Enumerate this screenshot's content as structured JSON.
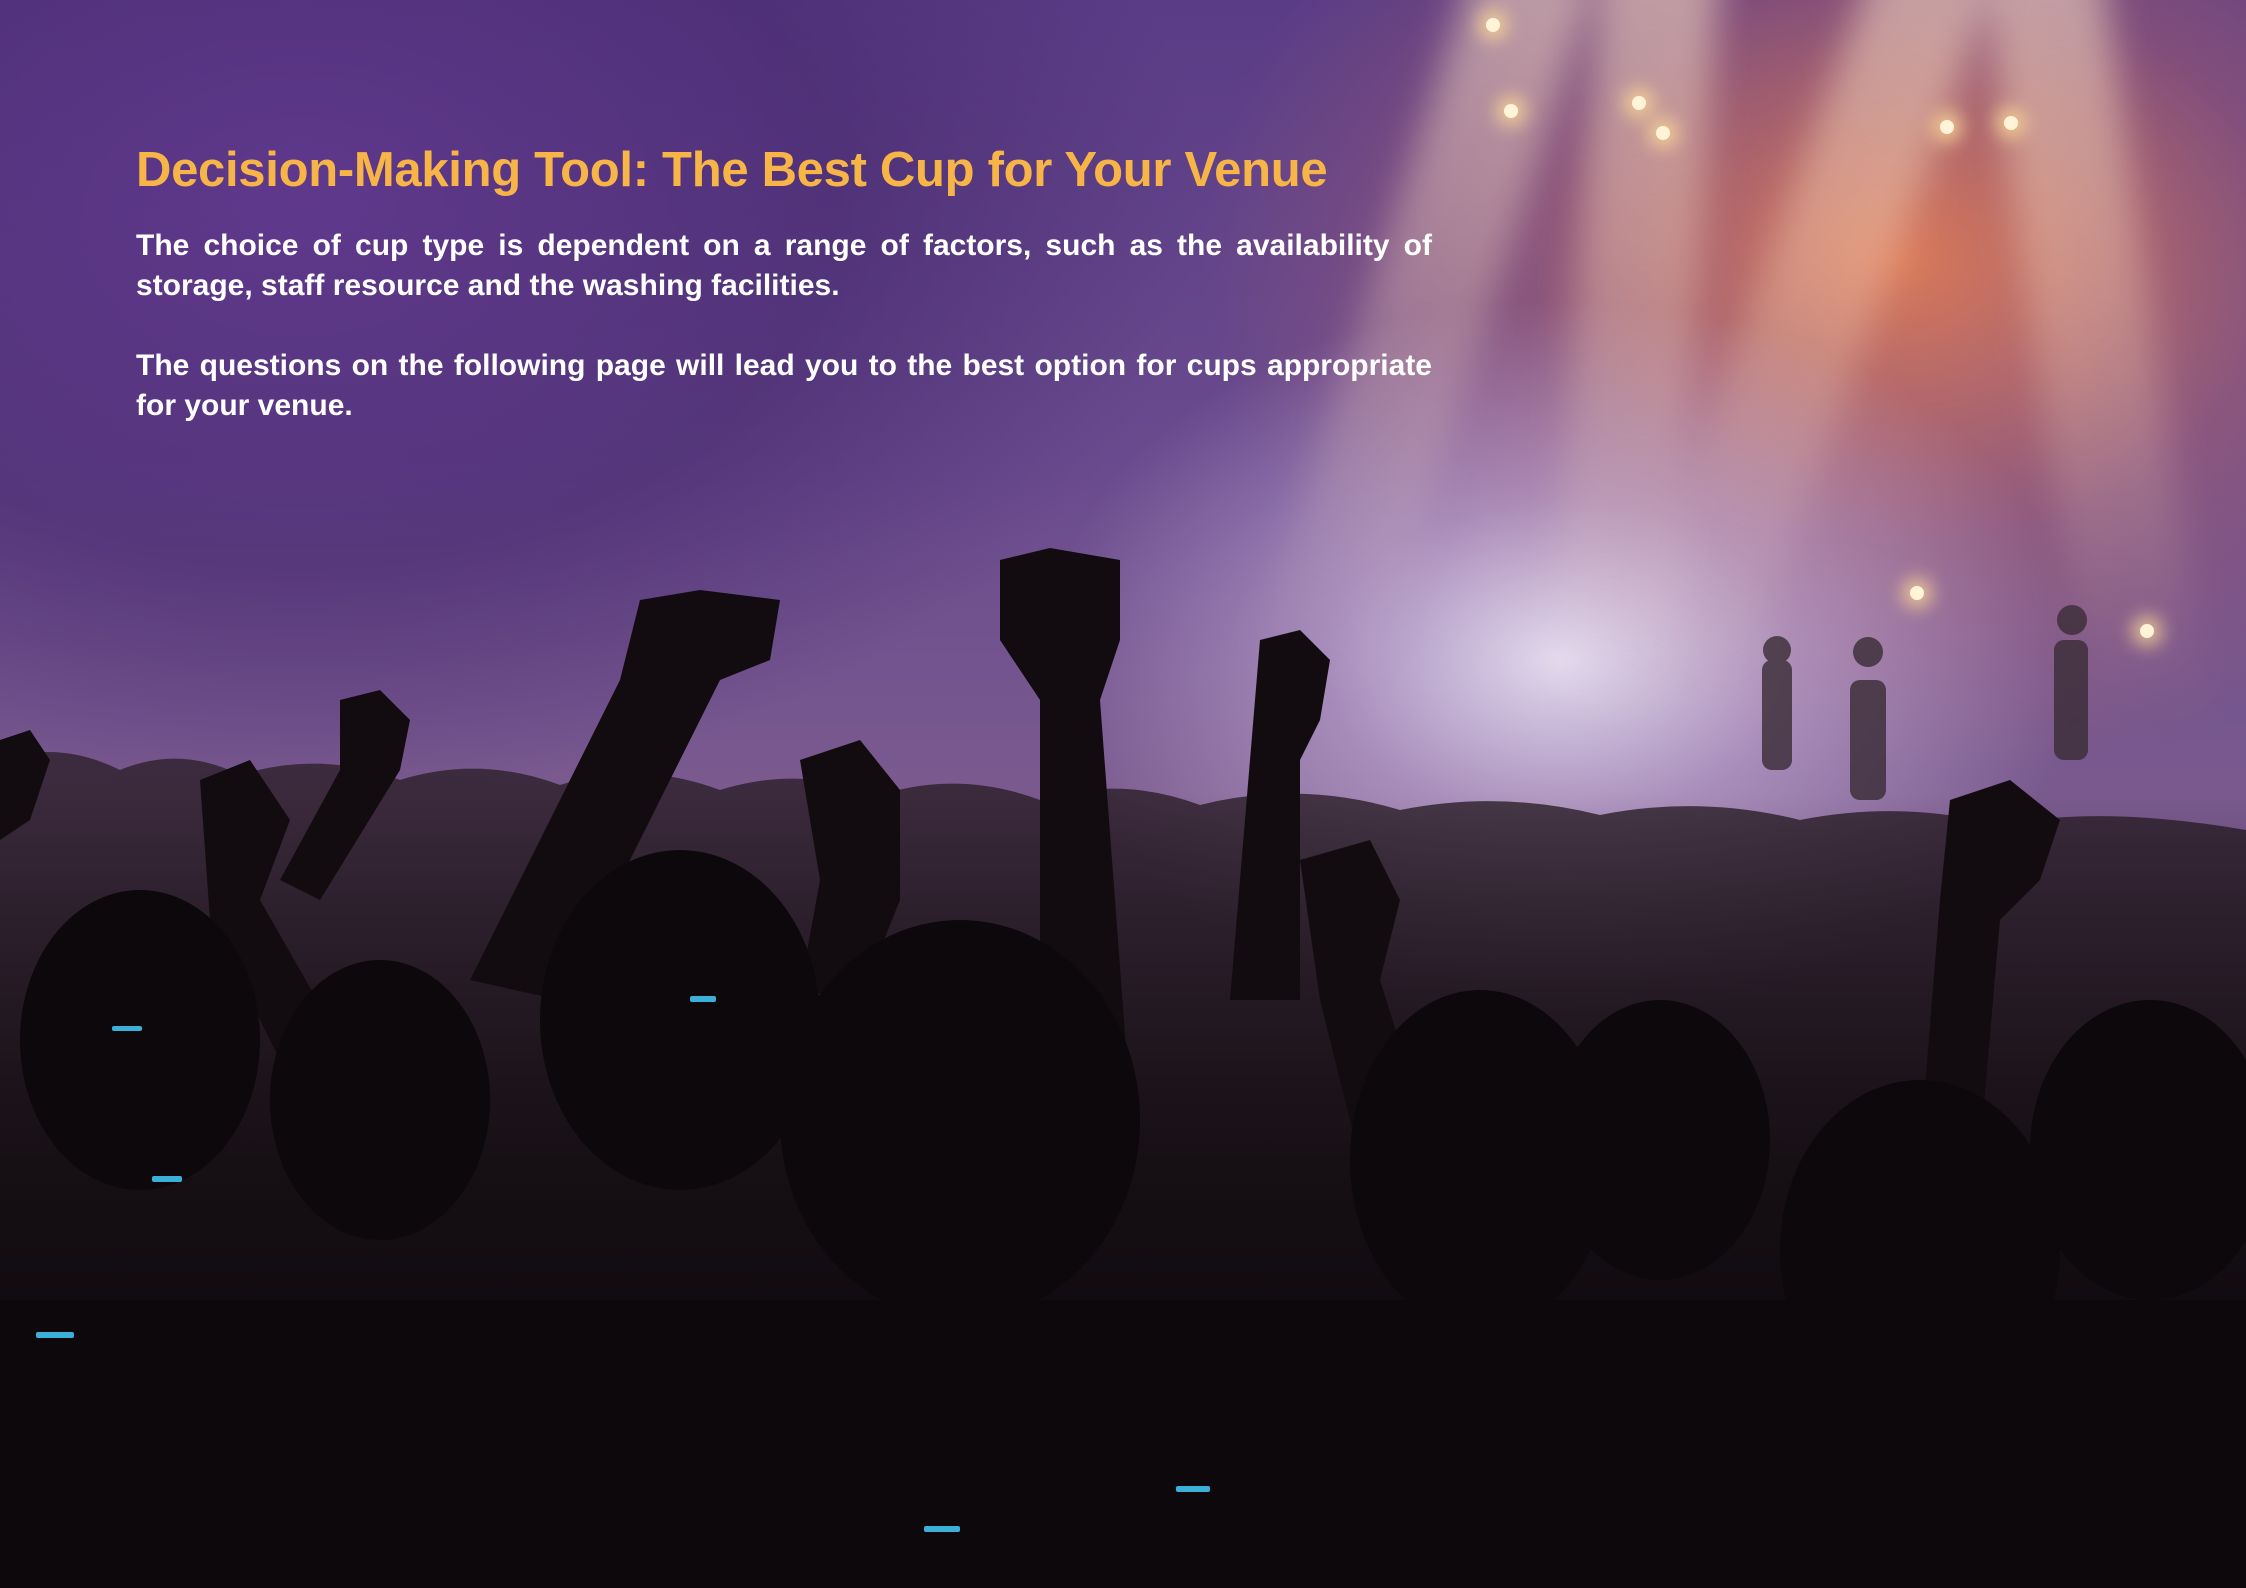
{
  "page": {
    "title": "Decision-Making Tool: The Best Cup for Your Venue",
    "paragraphs": [
      "The choice of cup type is dependent on a range of factors, such as the availability of storage, staff resource and the washing facilities.",
      "The questions on the following page will lead you to the best option for cups appropriate for your venue."
    ]
  },
  "colors": {
    "title": "#f7b548",
    "body_text": "#ffffff"
  },
  "background": {
    "description_icon": "concert-crowd-photo"
  }
}
